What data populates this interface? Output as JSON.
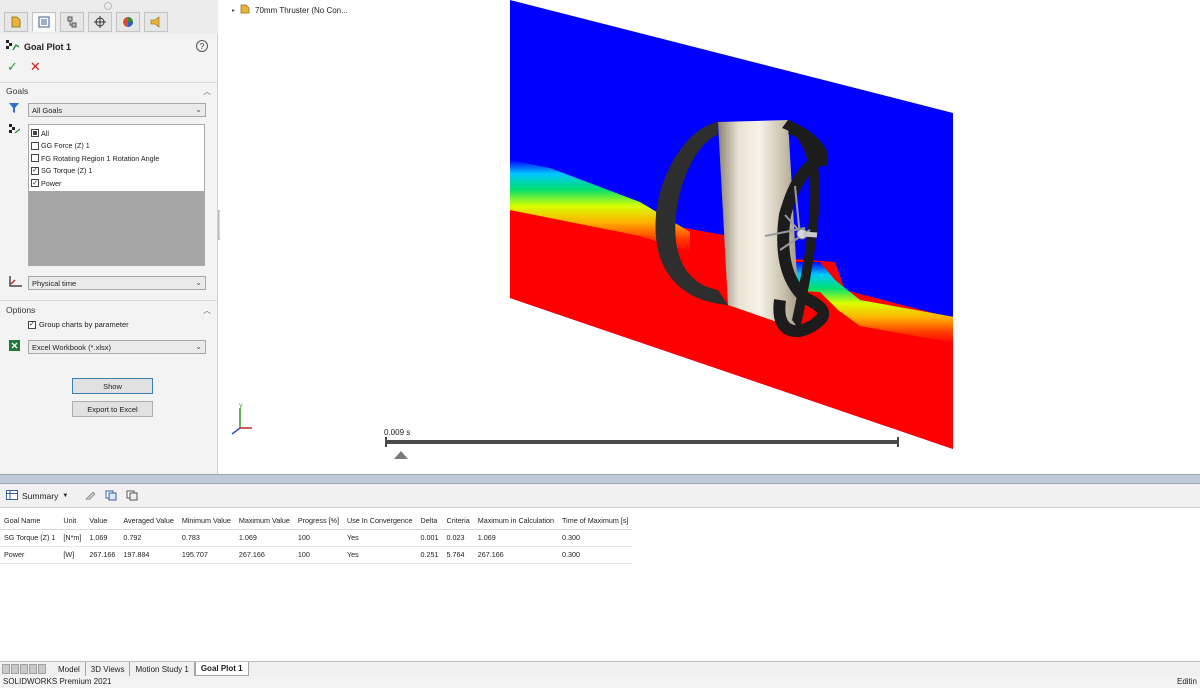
{
  "property_manager": {
    "title": "Goal Plot 1",
    "help_symbol": "?",
    "ok_symbol": "✓",
    "cancel_symbol": "✕",
    "goals": {
      "section_title": "Goals",
      "filter_value": "All Goals",
      "items": [
        {
          "label": "All",
          "state": "partial"
        },
        {
          "label": "GG Force (Z) 1",
          "state": "unchecked"
        },
        {
          "label": "FG Rotating Region 1 Rotation Angle",
          "state": "unchecked"
        },
        {
          "label": "SG Torque (Z) 1",
          "state": "checked"
        },
        {
          "label": "Power",
          "state": "checked"
        }
      ],
      "x_axis_value": "Physical time"
    },
    "options": {
      "section_title": "Options",
      "group_charts_label": "Group charts by parameter",
      "group_charts_checked": true,
      "export_format": "Excel Workbook (*.xlsx)",
      "show_button": "Show",
      "export_button": "Export to Excel"
    }
  },
  "graphics": {
    "tree_node_label": "70mm Thruster  (No Con...",
    "timeline_label": "0.009 s",
    "colors": {
      "red": "#ff0000",
      "blue": "#0000ff",
      "accent": "#3c7fb1"
    }
  },
  "results": {
    "view_label": "Summary",
    "columns": [
      "Goal Name",
      "Unit",
      "Value",
      "Averaged Value",
      "Minimum Value",
      "Maximum Value",
      "Progress [%]",
      "Use In Convergence",
      "Delta",
      "Criteria",
      "Maximum in Calculation",
      "Time of Maximum [s]"
    ],
    "rows": [
      [
        "SG Torque (Z) 1",
        "[N*m]",
        "1.069",
        "0.792",
        "0.783",
        "1.069",
        "100",
        "Yes",
        "0.001",
        "0.023",
        "1.069",
        "0.300"
      ],
      [
        "Power",
        "[W]",
        "267.166",
        "197.884",
        "195.707",
        "267.166",
        "100",
        "Yes",
        "0.251",
        "5.764",
        "267.166",
        "0.300"
      ]
    ]
  },
  "tabs": [
    {
      "label": "Model",
      "active": false
    },
    {
      "label": "3D Views",
      "active": false
    },
    {
      "label": "Motion Study 1",
      "active": false
    },
    {
      "label": "Goal Plot 1",
      "active": true
    }
  ],
  "status": {
    "left": "SOLIDWORKS Premium 2021",
    "right": "Editin"
  }
}
